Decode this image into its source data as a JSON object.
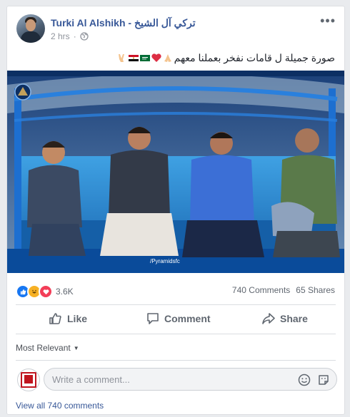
{
  "post": {
    "author": "Turki Al Alshikh - تركي آل الشيخ",
    "time": "2 hrs",
    "audience_icon": "globe-icon",
    "text": "صورة جميلة ل قامات نفخر بعملنا معهم",
    "emojis": [
      "folded-hands",
      "red-heart",
      "saudi-flag",
      "egypt-flag",
      "victory-hand"
    ],
    "photo_watermark": "/Pyramidsfc"
  },
  "reactions": {
    "icons": [
      "like",
      "haha",
      "love"
    ],
    "count": "3.6K",
    "comments": "740 Comments",
    "shares": "65 Shares"
  },
  "actions": {
    "like": "Like",
    "comment": "Comment",
    "share": "Share"
  },
  "comments": {
    "sort_label": "Most Relevant",
    "placeholder": "Write a comment...",
    "view_all": "View all 740 comments"
  },
  "colors": {
    "link": "#385898",
    "like": "#1877f2",
    "love": "#f33e58",
    "haha": "#f7b125"
  }
}
